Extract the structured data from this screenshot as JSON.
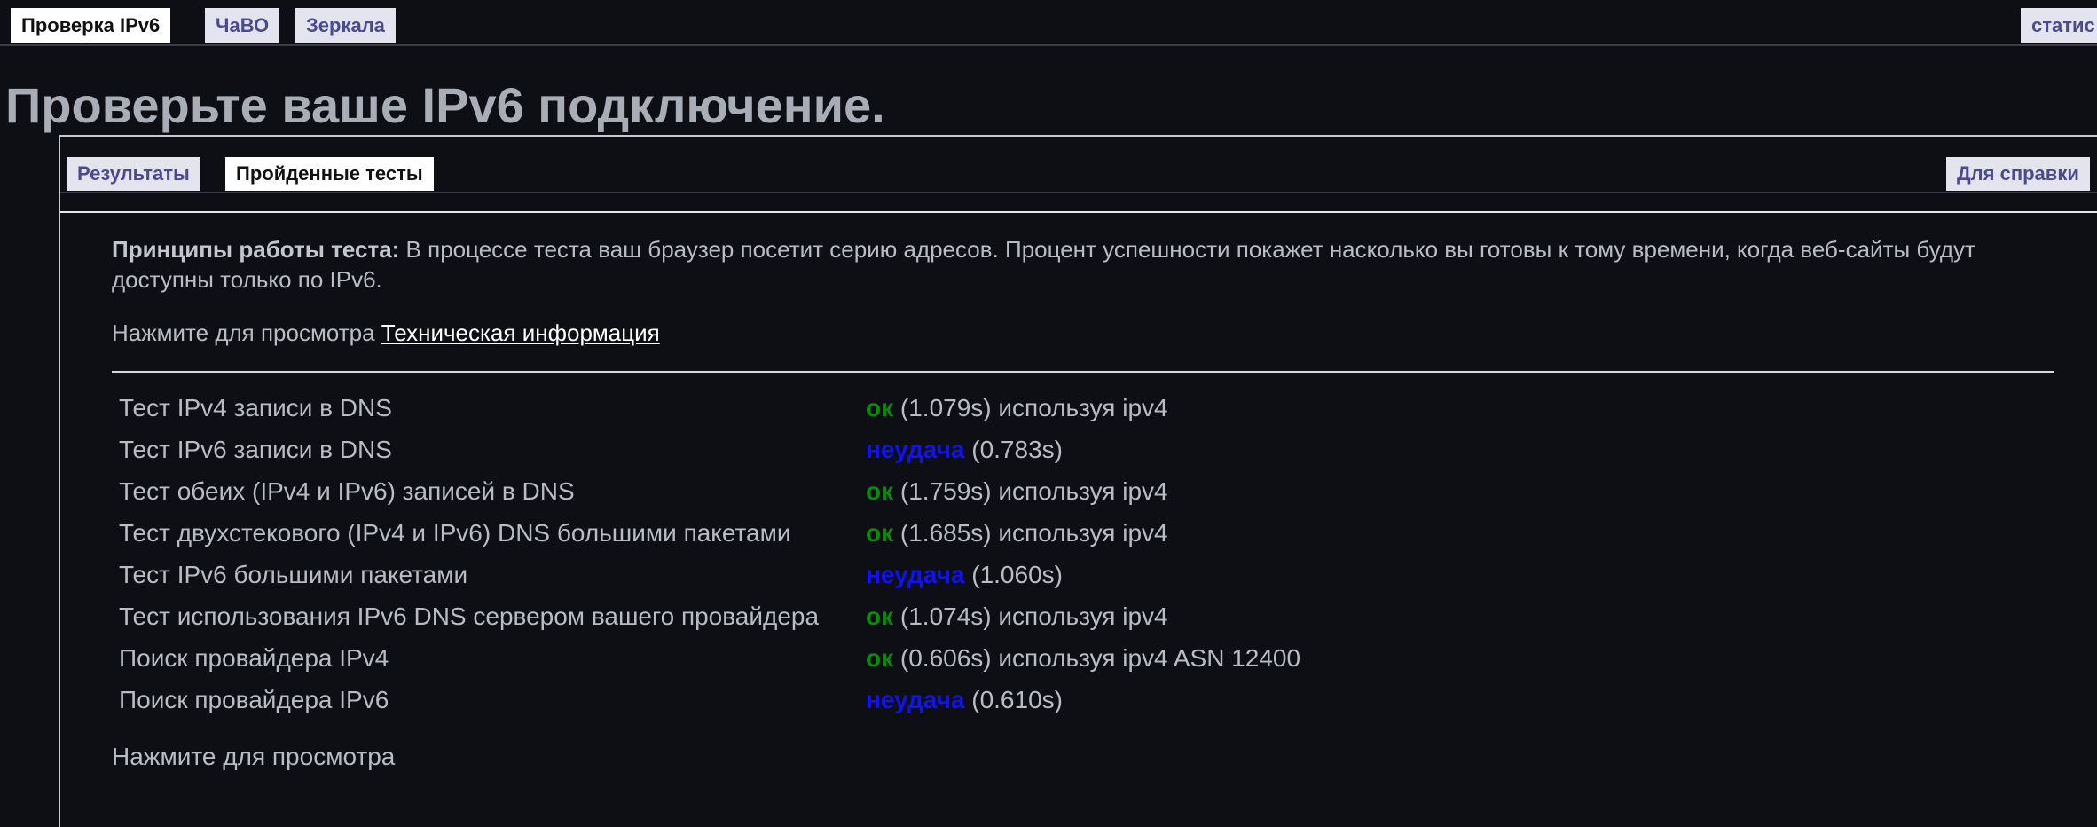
{
  "nav": {
    "tabs": [
      {
        "label": "Проверка IPv6",
        "active": true
      },
      {
        "label": "ЧаВО",
        "active": false
      },
      {
        "label": "Зеркала",
        "active": false
      }
    ],
    "right_tab": "статис"
  },
  "page_title": "Проверьте ваше IPv6 подключение.",
  "subtabs": [
    {
      "label": "Результаты",
      "active": false
    },
    {
      "label": "Пройденные тесты",
      "active": true
    }
  ],
  "subtab_right": "Для справки",
  "principles": {
    "heading": "Принципы работы теста:",
    "text": " В процессе теста ваш браузер посетит серию адресов. Процент успешности покажет насколько вы готовы к тому времени, когда веб-сайты будут доступны только по IPv6."
  },
  "tech_info": {
    "prefix": "Нажмите для просмотра ",
    "link": "Техническая информация"
  },
  "tests": [
    {
      "name": "Тест IPv4 записи в DNS",
      "status": "ок",
      "result": "ok",
      "detail": " (1.079s) используя ipv4"
    },
    {
      "name": "Тест IPv6 записи в DNS",
      "status": "неудача",
      "result": "fail",
      "detail": " (0.783s)"
    },
    {
      "name": "Тест обеих (IPv4 и IPv6) записей в DNS",
      "status": "ок",
      "result": "ok",
      "detail": " (1.759s) используя ipv4"
    },
    {
      "name": "Тест двухстекового (IPv4 и IPv6) DNS большими пакетами",
      "status": "ок",
      "result": "ok",
      "detail": " (1.685s) используя ipv4"
    },
    {
      "name": "Тест IPv6 большими пакетами",
      "status": "неудача",
      "result": "fail",
      "detail": " (1.060s)"
    },
    {
      "name": "Тест использования IPv6 DNS сервером вашего провайдера",
      "status": "ок",
      "result": "ok",
      "detail": " (1.074s) используя ipv4"
    },
    {
      "name": "Поиск провайдера IPv4",
      "status": "ок",
      "result": "ok",
      "detail": " (0.606s) используя ipv4 ASN 12400"
    },
    {
      "name": "Поиск провайдера IPv6",
      "status": "неудача",
      "result": "fail",
      "detail": " (0.610s)"
    }
  ],
  "bottom_text": "Нажмите для просмотра",
  "colors": {
    "background": "#0d0f14",
    "ok": "#0b8a0b",
    "fail": "#1212ee",
    "tab_inactive_text": "#4a4a8f"
  }
}
